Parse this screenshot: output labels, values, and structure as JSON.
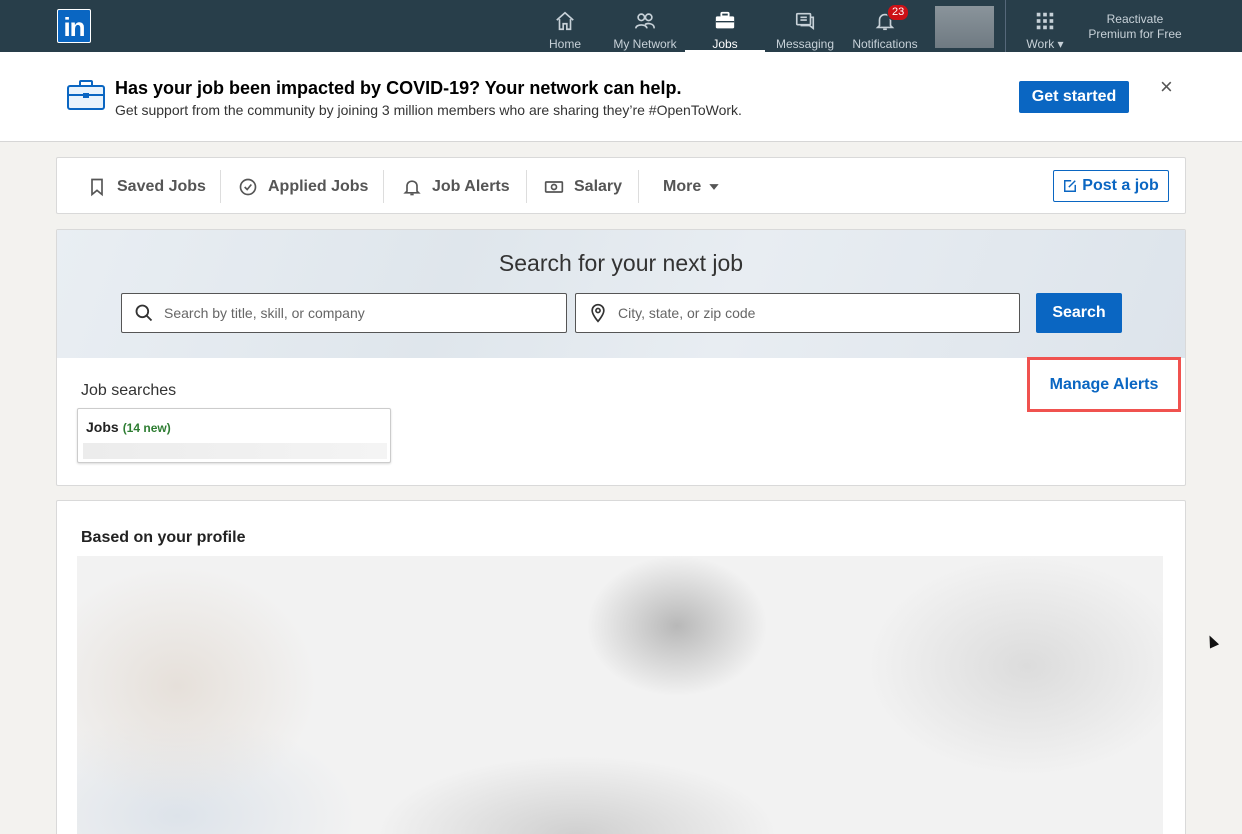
{
  "nav": {
    "items": [
      {
        "label": "Home",
        "icon": "home-icon"
      },
      {
        "label": "My Network",
        "icon": "people-icon"
      },
      {
        "label": "Jobs",
        "icon": "briefcase-icon",
        "active": true
      },
      {
        "label": "Messaging",
        "icon": "messaging-icon"
      },
      {
        "label": "Notifications",
        "icon": "bell-icon",
        "badge": "23"
      }
    ],
    "work_label": "Work",
    "premium_line1": "Reactivate",
    "premium_line2": "Premium for Free"
  },
  "banner": {
    "title": "Has your job been impacted by COVID-19? Your network can help.",
    "subtitle": "Get support from the community by joining 3 million members who are sharing they’re #OpenToWork.",
    "cta": "Get started",
    "close": "×"
  },
  "tabs": {
    "items": [
      {
        "label": "Saved Jobs",
        "icon": "bookmark-icon"
      },
      {
        "label": "Applied Jobs",
        "icon": "check-circle-icon"
      },
      {
        "label": "Job Alerts",
        "icon": "bell-icon"
      },
      {
        "label": "Salary",
        "icon": "money-icon"
      },
      {
        "label": "More",
        "icon": "caret-down-icon"
      }
    ],
    "post_job": "Post a job"
  },
  "search": {
    "title": "Search for your next job",
    "keyword_placeholder": "Search by title, skill, or company",
    "location_placeholder": "City, state, or zip code",
    "button": "Search"
  },
  "job_searches": {
    "heading": "Job searches",
    "manage_alerts": "Manage Alerts",
    "saved": [
      {
        "name": "Jobs",
        "new_count": "(14 new)"
      }
    ]
  },
  "profile_section": {
    "title": "Based on your profile"
  },
  "colors": {
    "nav_bg": "#283e4a",
    "primary": "#0a66c2",
    "highlight": "#f0524f",
    "new_badge": "#2e7d32"
  }
}
